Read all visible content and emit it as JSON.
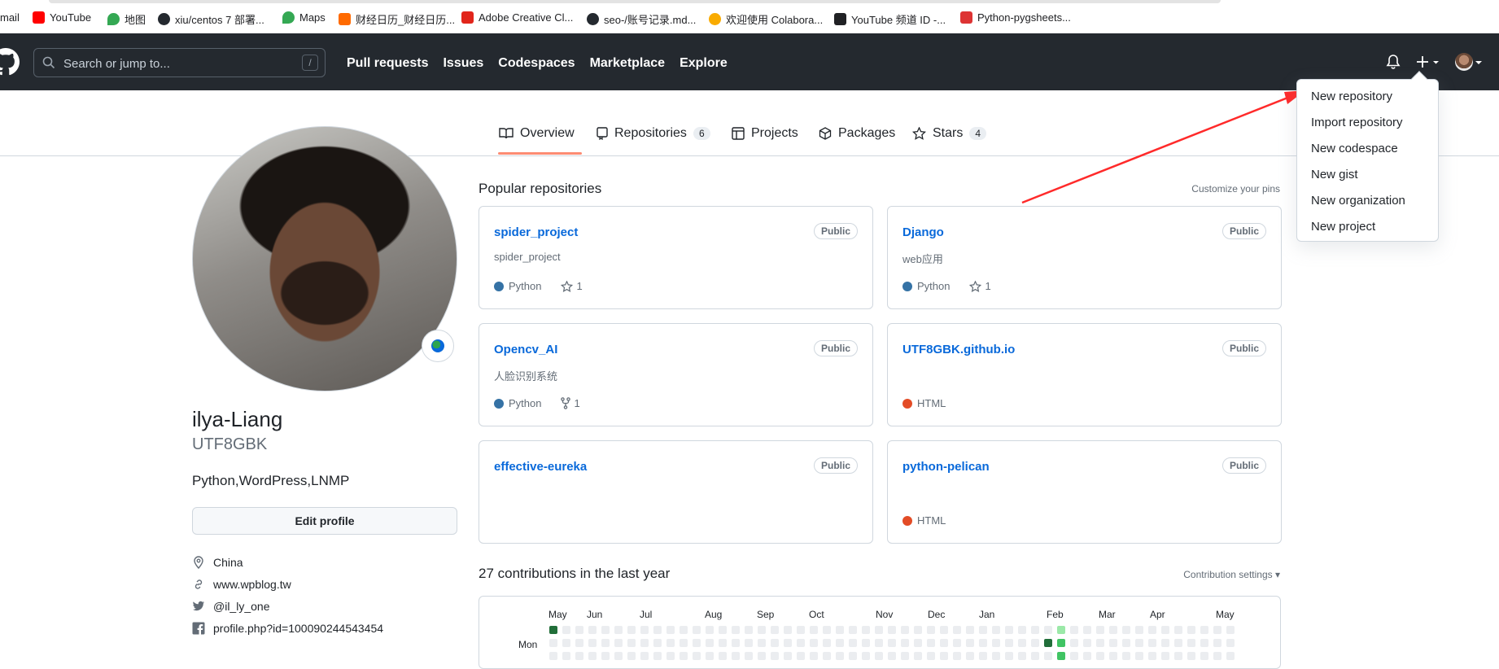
{
  "bookmarks": [
    {
      "label": "mail",
      "color": ""
    },
    {
      "label": "YouTube",
      "color": "#ff0000"
    },
    {
      "label": "地图",
      "color": "#34a853"
    },
    {
      "label": "xiu/centos 7 部署...",
      "color": "#24292f"
    },
    {
      "label": "Maps",
      "color": "#34a853"
    },
    {
      "label": "财经日历_财经日历...",
      "color": "#ff6a00"
    },
    {
      "label": "Adobe Creative Cl...",
      "color": "#e1251b"
    },
    {
      "label": "seo-/账号记录.md...",
      "color": "#24292f"
    },
    {
      "label": "欢迎使用 Colabora...",
      "color": "#f9ab00"
    },
    {
      "label": "YouTube 频道 ID -...",
      "color": "#202124"
    },
    {
      "label": "Python-pygsheets...",
      "color": "#d33"
    }
  ],
  "header": {
    "search_placeholder": "Search or jump to...",
    "search_shortcut": "/",
    "nav": [
      "Pull requests",
      "Issues",
      "Codespaces",
      "Marketplace",
      "Explore"
    ]
  },
  "tabs": [
    {
      "label": "Overview",
      "count": null,
      "icon": "book-icon"
    },
    {
      "label": "Repositories",
      "count": "6",
      "icon": "repo-icon"
    },
    {
      "label": "Projects",
      "count": null,
      "icon": "table-icon"
    },
    {
      "label": "Packages",
      "count": null,
      "icon": "package-icon"
    },
    {
      "label": "Stars",
      "count": "4",
      "icon": "star-icon"
    }
  ],
  "profile": {
    "name": "ilya-Liang",
    "login": "UTF8GBK",
    "bio": "Python,WordPress,LNMP",
    "edit_label": "Edit profile",
    "location": "China",
    "website": "www.wpblog.tw",
    "twitter": "@il_ly_one",
    "facebook": "profile.php?id=100090244543454"
  },
  "popular": {
    "title": "Popular repositories",
    "customize": "Customize your pins",
    "repos": [
      {
        "name": "spider_project",
        "badge": "Public",
        "desc": "spider_project",
        "lang": "Python",
        "lang_color": "#3572A5",
        "stat_icon": "star-icon",
        "stat": "1"
      },
      {
        "name": "Django",
        "badge": "Public",
        "desc": "web应用",
        "lang": "Python",
        "lang_color": "#3572A5",
        "stat_icon": "star-icon",
        "stat": "1"
      },
      {
        "name": "Opencv_AI",
        "badge": "Public",
        "desc": "人脸识别系统",
        "lang": "Python",
        "lang_color": "#3572A5",
        "stat_icon": "fork-icon",
        "stat": "1"
      },
      {
        "name": "UTF8GBK.github.io",
        "badge": "Public",
        "desc": "",
        "lang": "HTML",
        "lang_color": "#e34c26",
        "stat_icon": "",
        "stat": ""
      },
      {
        "name": "effective-eureka",
        "badge": "Public",
        "desc": "",
        "lang": "",
        "lang_color": "",
        "stat_icon": "",
        "stat": ""
      },
      {
        "name": "python-pelican",
        "badge": "Public",
        "desc": "",
        "lang": "HTML",
        "lang_color": "#e34c26",
        "stat_icon": "",
        "stat": ""
      }
    ]
  },
  "contributions": {
    "title": "27 contributions in the last year",
    "settings": "Contribution settings ▾",
    "months": [
      "May",
      "Jun",
      "Jul",
      "Aug",
      "Sep",
      "Oct",
      "Nov",
      "Dec",
      "Jan",
      "Feb",
      "Mar",
      "Apr",
      "May"
    ],
    "day_label": "Mon"
  },
  "dropdown": {
    "items": [
      "New repository",
      "Import repository",
      "New codespace",
      "New gist",
      "New organization",
      "New project"
    ]
  },
  "colors": {
    "header_bg": "#24292f",
    "link": "#0969da",
    "tab_underline": "#fd8c73",
    "annotation_arrow": "#ff2a2a"
  }
}
